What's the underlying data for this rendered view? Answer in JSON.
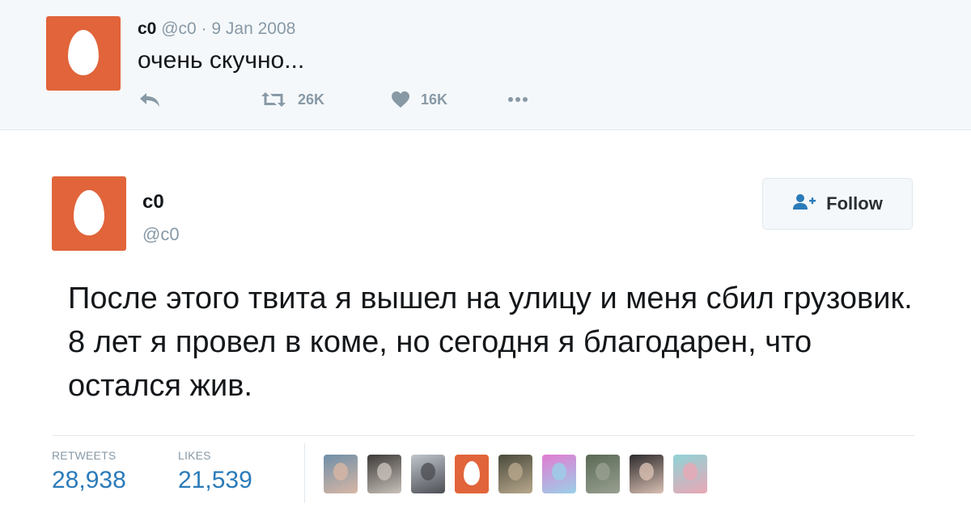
{
  "reply_context": {
    "name": "c0",
    "handle": "@c0",
    "separator": "·",
    "date": "9 Jan 2008",
    "text": "очень скучно...",
    "actions": {
      "reply_icon": "reply-icon",
      "retweet_icon": "retweet-icon",
      "retweet_count": "26K",
      "like_icon": "heart-icon",
      "like_count": "16K",
      "more_icon": "more-dots-icon"
    }
  },
  "tweet": {
    "name": "c0",
    "handle": "@c0",
    "follow_label": "Follow",
    "follow_icon": "add-user-icon",
    "text": "После этого твита я вышел на улицу и меня сбил грузовик. 8 лет я провел в коме, но сегодня я благодарен, что остался жив.",
    "stats": {
      "retweets_label": "RETWEETS",
      "retweets": "28,938",
      "likes_label": "LIKES",
      "likes": "21,539"
    },
    "liker_avatars": [
      {
        "kind": "photo",
        "colors": [
          "#6f8fa8",
          "#d8b7a5"
        ]
      },
      {
        "kind": "photo",
        "colors": [
          "#3d3a38",
          "#c9c2bb"
        ]
      },
      {
        "kind": "photo",
        "colors": [
          "#bfc6cc",
          "#4d4f55"
        ]
      },
      {
        "kind": "egg",
        "colors": [
          "#e1643a",
          "#ffffff"
        ]
      },
      {
        "kind": "photo",
        "colors": [
          "#4a4a3c",
          "#b8a88c"
        ]
      },
      {
        "kind": "photo",
        "colors": [
          "#e27bd1",
          "#9ad0e8"
        ]
      },
      {
        "kind": "photo",
        "colors": [
          "#5a6a55",
          "#99a091"
        ]
      },
      {
        "kind": "photo",
        "colors": [
          "#2d2a2c",
          "#d9c0b3"
        ]
      },
      {
        "kind": "photo",
        "colors": [
          "#8fd3d6",
          "#e9a7b5"
        ]
      }
    ]
  },
  "colors": {
    "egg_orange": "#e1643a",
    "link_blue": "#2b7bb9",
    "muted_gray": "#8899a6"
  }
}
